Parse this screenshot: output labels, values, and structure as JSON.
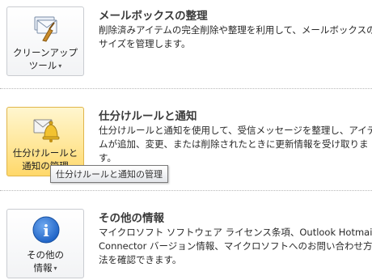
{
  "sections": [
    {
      "button_line1": "クリーンアップ",
      "button_line2": "ツール",
      "title": "メールボックスの整理",
      "description": "削除済みアイテムの完全削除や整理を利用して、メールボックスのサイズを管理します。"
    },
    {
      "button_line1": "仕分けルールと",
      "button_line2": "通知の管理",
      "title": "仕分けルールと通知",
      "description": "仕分けルールと通知を使用して、受信メッセージを整理し、アイテムが追加、変更、または削除されたときに更新情報を受け取ります。"
    },
    {
      "button_line1": "その他の",
      "button_line2": "情報",
      "title": "その他の情報",
      "description": "マイクロソフト ソフトウェア ライセンス条項、Outlook Hotmail Connector バージョン情報、マイクロソフトへのお問い合わせ方法を確認できます。"
    }
  ],
  "tooltip": "仕分けルールと通知の管理",
  "icons": {
    "cleanup": "cleanup-tools-icon",
    "rules": "rules-alerts-icon",
    "info": "info-icon",
    "info_glyph": "i",
    "caret": "▾"
  },
  "colors": {
    "active_button": "#ffd86a",
    "info_blue": "#1f63c6"
  }
}
